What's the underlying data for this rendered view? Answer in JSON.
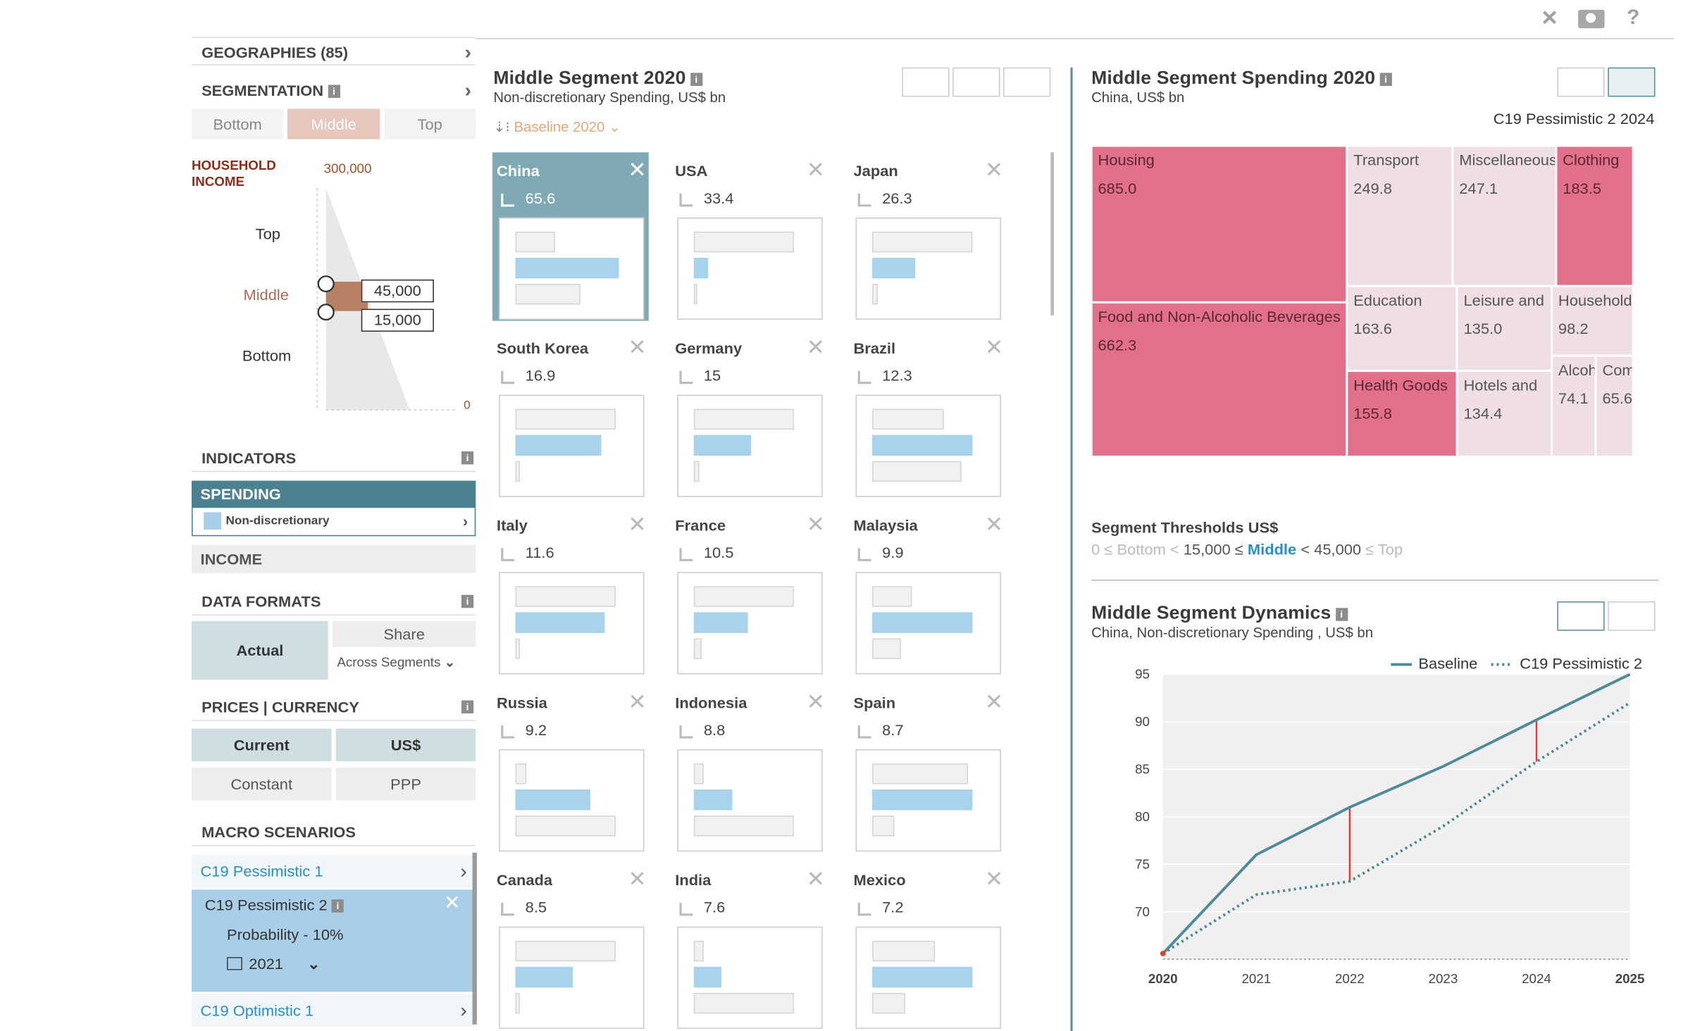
{
  "toolbar": {
    "close": "✕",
    "help": "?"
  },
  "left": {
    "geographies": "GEOGRAPHIES (85)",
    "segmentation": "SEGMENTATION",
    "tabs": [
      "Bottom",
      "Middle",
      "Top"
    ],
    "household": "HOUSEHOLD",
    "income": "INCOME",
    "max": "300,000",
    "min": "0",
    "top": "Top",
    "middle": "Middle",
    "bottom": "Bottom",
    "upper": "45,000",
    "lower": "15,000",
    "indicators": "INDICATORS",
    "spending": "SPENDING",
    "nondisc": "Non-discretionary",
    "income_row": "INCOME",
    "data_formats": "DATA FORMATS",
    "actual": "Actual",
    "share": "Share",
    "across": "Across Segments",
    "prices": "PRICES | CURRENCY",
    "current": "Current",
    "usd": "US$",
    "constant": "Constant",
    "ppp": "PPP",
    "macro": "MACRO SCENARIOS",
    "s1": "C19 Pessimistic 1",
    "s2": "C19 Pessimistic 2",
    "prob": "Probability - 10%",
    "year": "2021",
    "s3": "C19 Optimistic 1"
  },
  "middle": {
    "title": "Middle Segment 2020",
    "subtitle": "Non-discretionary Spending, US$ bn",
    "sort": "Baseline 2020",
    "cards": [
      {
        "name": "China",
        "value": "65.6",
        "bars": [
          0.28,
          0.72,
          0.45
        ]
      },
      {
        "name": "USA",
        "value": "33.4",
        "bars": [
          0.7,
          0.1,
          0.02
        ]
      },
      {
        "name": "Japan",
        "value": "26.3",
        "bars": [
          0.7,
          0.3,
          0.04
        ]
      },
      {
        "name": "South Korea",
        "value": "16.9",
        "bars": [
          0.7,
          0.6,
          0.03
        ]
      },
      {
        "name": "Germany",
        "value": "15",
        "bars": [
          0.7,
          0.4,
          0.04
        ]
      },
      {
        "name": "Brazil",
        "value": "12.3",
        "bars": [
          0.5,
          0.7,
          0.62
        ]
      },
      {
        "name": "Italy",
        "value": "11.6",
        "bars": [
          0.7,
          0.62,
          0.03
        ]
      },
      {
        "name": "France",
        "value": "10.5",
        "bars": [
          0.7,
          0.38,
          0.05
        ]
      },
      {
        "name": "Malaysia",
        "value": "9.9",
        "bars": [
          0.28,
          0.7,
          0.2
        ]
      },
      {
        "name": "Russia",
        "value": "9.2",
        "bars": [
          0.08,
          0.52,
          0.7
        ]
      },
      {
        "name": "Indonesia",
        "value": "8.8",
        "bars": [
          0.07,
          0.27,
          0.7
        ]
      },
      {
        "name": "Spain",
        "value": "8.7",
        "bars": [
          0.67,
          0.7,
          0.15
        ]
      },
      {
        "name": "Canada",
        "value": "8.5",
        "bars": [
          0.7,
          0.4,
          0.03
        ]
      },
      {
        "name": "India",
        "value": "7.6",
        "bars": [
          0.07,
          0.19,
          0.7
        ]
      },
      {
        "name": "Mexico",
        "value": "7.2",
        "bars": [
          0.44,
          0.7,
          0.23
        ]
      }
    ]
  },
  "right": {
    "title": "Middle Segment Spending 2020",
    "subtitle": "China, US$ bn",
    "scenario": "C19 Pessimistic 2 2024",
    "treemap": [
      {
        "label": "Housing",
        "value": "685.0"
      },
      {
        "label": "Food and Non-Alcoholic Beverages",
        "value": "662.3"
      },
      {
        "label": "Transport",
        "value": "249.8"
      },
      {
        "label": "Miscellaneous",
        "value": "247.1"
      },
      {
        "label": "Clothing",
        "value": "183.5"
      },
      {
        "label": "Education",
        "value": "163.6"
      },
      {
        "label": "Leisure and",
        "value": "135.0"
      },
      {
        "label": "Household",
        "value": "98.2"
      },
      {
        "label": "Health Goods",
        "value": "155.8"
      },
      {
        "label": "Hotels and",
        "value": "134.4"
      },
      {
        "label": "Alcohol",
        "value": "74.1"
      },
      {
        "label": "Communication",
        "value": "65.6"
      }
    ],
    "thr_title": "Segment Thresholds US$",
    "thr": {
      "a": "0 ≤ Bottom <",
      "b": "15,000 ≤",
      "c": "Middle",
      "d": "< 45,000",
      "e": "≤ Top"
    },
    "dyn_title": "Middle Segment Dynamics",
    "dyn_sub": "China, Non-discretionary Spending , US$ bn"
  },
  "colors": {
    "accent": "#4c8191",
    "hot": "#e3708a",
    "cool": "#f0dfe2",
    "blue": "#a9cfe8",
    "link": "#2a8fc7"
  },
  "chart_data": {
    "type": "line",
    "x": [
      2020,
      2021,
      2022,
      2023,
      2024,
      2025
    ],
    "series": [
      {
        "name": "Baseline",
        "values": [
          65.6,
          76.0,
          81.0,
          85.3,
          90.2,
          95.0
        ]
      },
      {
        "name": "C19 Pessimistic 2",
        "values": [
          65.6,
          71.8,
          73.2,
          79.0,
          85.8,
          92.0
        ]
      }
    ],
    "ylim": [
      65,
      95
    ],
    "yticks": [
      70,
      75,
      80,
      85,
      90,
      95
    ],
    "legend": "top-right"
  }
}
